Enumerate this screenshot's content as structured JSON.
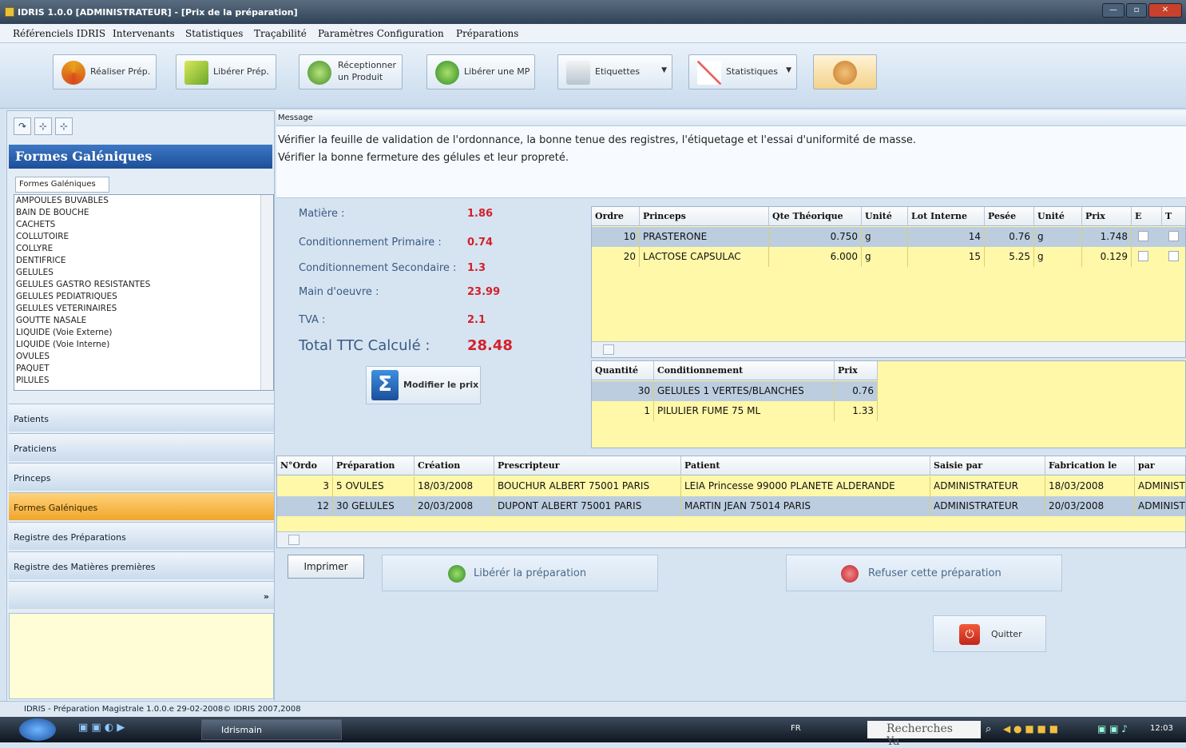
{
  "window": {
    "title": "IDRIS 1.0.0 [ADMINISTRATEUR] - [Prix de la préparation]"
  },
  "menu": [
    "Référenciels IDRIS",
    "Intervenants",
    "Statistiques",
    "Traçabilité",
    "Paramètres Configuration",
    "Préparations"
  ],
  "toolbar": {
    "realiser": "Réaliser Prép.",
    "liberer": "Libérer Prép.",
    "receptionner_1": "Réceptionner",
    "receptionner_2": "un Produit",
    "liberer_mp": "Libérer une MP",
    "etiquettes": "Etiquettes",
    "statistiques": "Statistiques"
  },
  "left": {
    "header": "Formes Galéniques",
    "tab": "Formes Galéniques",
    "list": [
      "AMPOULES BUVABLES",
      "BAIN DE BOUCHE",
      "CACHETS",
      "COLLUTOIRE",
      "COLLYRE",
      "DENTIFRICE",
      "GELULES",
      "GELULES GASTRO RESISTANTES",
      "GELULES PEDIATRIQUES",
      "GELULES VETERINAIRES",
      "GOUTTE NASALE",
      "LIQUIDE (Voie Externe)",
      "LIQUIDE (Voie Interne)",
      "OVULES",
      "PAQUET",
      "PILULES"
    ],
    "nav": [
      "Patients",
      "Praticiens",
      "Princeps",
      "Formes Galéniques",
      "Registre des Préparations",
      "Registre des Matières premières"
    ]
  },
  "message": {
    "label": "Message",
    "line1": "Vérifier la feuille de validation de l'ordonnance, la bonne tenue des registres, l'étiquetage et l'essai d'uniformité de masse.",
    "line2": "Vérifier la bonne fermeture des gélules et leur propreté."
  },
  "costs": {
    "matiere_label": "Matière :",
    "matiere_value": "1.86",
    "cond_prim_label": "Conditionnement Primaire :",
    "cond_prim_value": "0.74",
    "cond_sec_label": "Conditionnement Secondaire :",
    "cond_sec_value": "1.3",
    "main_label": "Main d'oeuvre :",
    "main_value": "23.99",
    "tva_label": "TVA :",
    "tva_value": "2.1",
    "total_label": "Total TTC Calculé :",
    "total_value": "28.48",
    "modifier_button": "Modifier le prix"
  },
  "princeps_table": {
    "headers": [
      "Ordre",
      "Princeps",
      "Qte Théorique",
      "Unité",
      "Lot Interne",
      "Pesée",
      "Unité",
      "Prix",
      "E",
      "T"
    ],
    "rows": [
      [
        "10",
        "PRASTERONE",
        "0.750",
        "g",
        "14",
        "0.76",
        "g",
        "1.748"
      ],
      [
        "20",
        "LACTOSE CAPSULAC",
        "6.000",
        "g",
        "15",
        "5.25",
        "g",
        "0.129"
      ]
    ]
  },
  "cond_table": {
    "headers": [
      "Quantité",
      "Conditionnement",
      "Prix"
    ],
    "rows": [
      [
        "30",
        "GELULES 1 VERTES/BLANCHES",
        "0.76"
      ],
      [
        "1",
        "PILULIER FUME 75 ML",
        "1.33"
      ]
    ]
  },
  "prep_table": {
    "headers": [
      "N°Ordo",
      "Préparation",
      "Création",
      "Prescripteur",
      "Patient",
      "Saisie par",
      "Fabrication le",
      "par"
    ],
    "rows": [
      [
        "3",
        "5 OVULES",
        "18/03/2008",
        "BOUCHUR ALBERT 75001 PARIS",
        "LEIA Princesse 99000 PLANETE ALDERANDE",
        "ADMINISTRATEUR",
        "18/03/2008",
        "ADMINIST"
      ],
      [
        "12",
        "30 GELULES",
        "20/03/2008",
        "DUPONT ALBERT 75001 PARIS",
        "MARTIN JEAN 75014 PARIS",
        "ADMINISTRATEUR",
        "20/03/2008",
        "ADMINIST"
      ]
    ]
  },
  "actions": {
    "imprimer": "Imprimer",
    "liberer": "Libérér la préparation",
    "refuser": "Refuser cette préparation",
    "quitter": "Quitter"
  },
  "status": "IDRIS - Préparation Magistrale 1.0.0.e 29-02-2008© IDRIS 2007,2008",
  "taskbar": {
    "app": "Idrismain",
    "lang": "FR",
    "search": "Recherches Ya",
    "time": "12:03"
  },
  "colors": {
    "accent": "#d4202a",
    "grid_yellow": "#fff8a8",
    "selection": "#bccde0",
    "active_nav": "#f0a62a"
  }
}
